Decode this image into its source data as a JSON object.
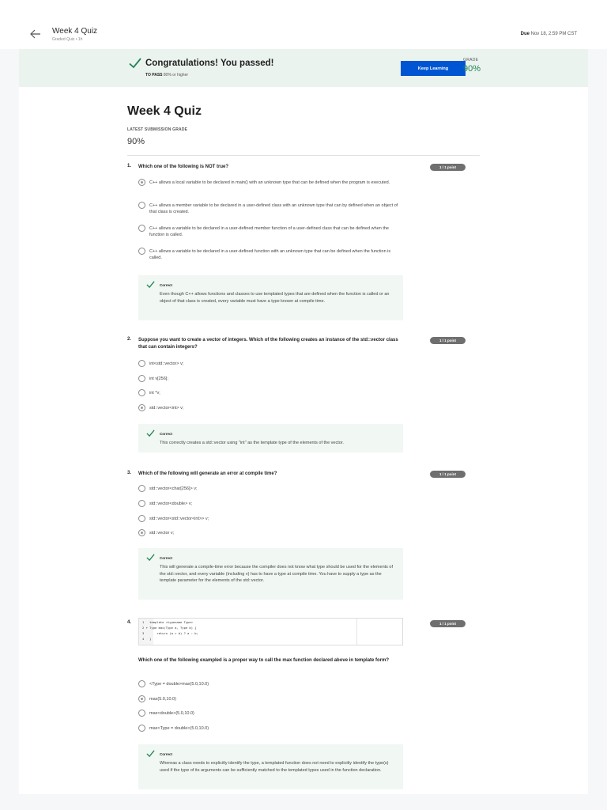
{
  "header": {
    "title": "Week 4 Quiz",
    "subtitle": "Graded Quiz • 1h",
    "due_label": "Due",
    "due_value": "Nov 18, 2:59 PM CST"
  },
  "banner": {
    "title": "Congratulations! You passed!",
    "to_pass_label": "TO PASS",
    "to_pass_value": "80% or higher",
    "keep_learning": "Keep Learning",
    "grade_label": "GRADE",
    "grade_value": "90%"
  },
  "quiz": {
    "title": "Week 4 Quiz",
    "latest_label": "LATEST SUBMISSION GRADE",
    "latest_value": "90%"
  },
  "colors": {
    "accent": "#0056d2",
    "success": "#1f8354",
    "banner_bg": "#ebf3ef"
  },
  "questions": [
    {
      "num": "1.",
      "text": "Which one of the following is NOT true?",
      "point": "1 / 1 point",
      "options": [
        "C++ allows a local variable to be declared in main() with an unknown type that can be defined when the program is executed.",
        "C++ allows a member variable to be declared in a user-defined class with an unknown type that can by defined when an object of that class is created.",
        "C++ allows a variable to be declared in a user-defined member function of a user-defined class that can be defined when the function is called.",
        "C++ allows a variable to be declared in a user-defined function with an unknown type that can be defined when the function is called."
      ],
      "selected": 0,
      "feedback_label": "Correct",
      "feedback": "Even though C++ allows functions and classes to use templated types that are defined when the function is called or an object of that class is created, every variable must have a type known at compile time."
    },
    {
      "num": "2.",
      "text": "Suppose you want to create a vector of integers. Which of the following creates an instance of the std::vector class that can contain integers?",
      "point": "1 / 1 point",
      "options": [
        "int<std::vector> v;",
        "int v[256];",
        "int *v;",
        "std::vector<int> v;"
      ],
      "selected": 3,
      "feedback_label": "Correct",
      "feedback": "This correctly creates a std::vector using \"int\" as the template type of the elements of the vector."
    },
    {
      "num": "3.",
      "text": "Which of the following will generate an error at compile time?",
      "point": "1 / 1 point",
      "options": [
        "std::vector<char[256]> v;",
        "std::vector<double> v;",
        "std::vector<std::vector<int>> v;",
        "std::vector v;"
      ],
      "selected": 3,
      "feedback_label": "Correct",
      "feedback": "This will generate a compile-time error because the compiler does not know what type should be used for the elements of the std::vector, and every variable (including v) has to have a type at compile time. You have to supply a type as the template parameter for the elements of the std::vector."
    },
    {
      "num": "4.",
      "code": [
        "1   template <typename Type>",
        "2 ▾ Type max(Type a, Type b) {",
        "3       return (a > b) ? a : b;",
        "4   }"
      ],
      "text": "Which one of the following exampled is a proper way to call the max function declared above in template form?",
      "point": "1 / 1 point",
      "options": [
        "<Type = double>max(5.0,10.0)",
        "max(5.0,10.0)",
        "max<double>(5.0,10.0)",
        "max<Type = double>(5.0,10.0)"
      ],
      "selected": 1,
      "feedback_label": "Correct",
      "feedback": "Whereas a class needs to explicitly identify the type, a templated function does not need to explicitly identify the type(s) used if the type of its arguments can be sufficiently matched to the templated types used in the function declaration."
    }
  ]
}
